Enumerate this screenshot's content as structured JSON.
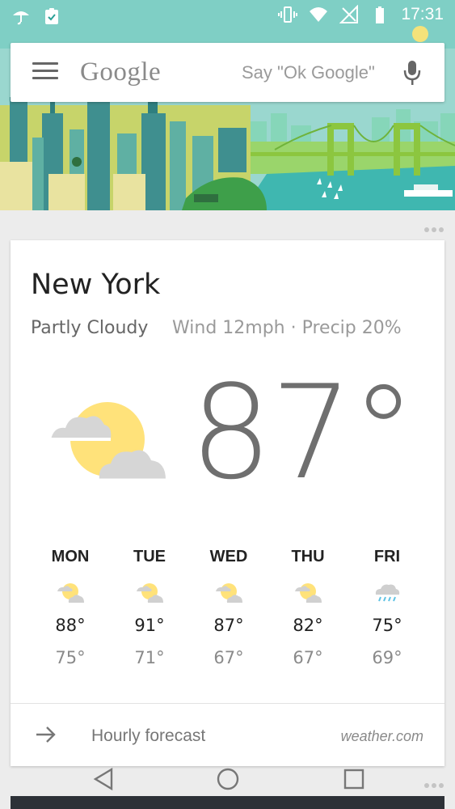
{
  "status_bar": {
    "time": "17:31",
    "left_icons": [
      "umbrella-icon",
      "clipboard-check-icon"
    ],
    "right_icons": [
      "vibrate-icon",
      "wifi-icon",
      "no-signal-icon",
      "battery-icon"
    ]
  },
  "search": {
    "logo": "Google",
    "placeholder": "Say \"Ok Google\"",
    "menu_icon": "hamburger-menu-icon",
    "mic_icon": "microphone-icon"
  },
  "weather": {
    "city": "New York",
    "condition": "Partly Cloudy",
    "details": "Wind 12mph · Precip 20%",
    "temperature": "87°",
    "icon": "partly-cloudy-icon",
    "forecast": [
      {
        "day": "MON",
        "high": "88°",
        "low": "75°",
        "icon": "partly-cloudy-icon"
      },
      {
        "day": "TUE",
        "high": "91°",
        "low": "71°",
        "icon": "partly-cloudy-icon"
      },
      {
        "day": "WED",
        "high": "87°",
        "low": "67°",
        "icon": "partly-cloudy-icon"
      },
      {
        "day": "THU",
        "high": "82°",
        "low": "67°",
        "icon": "partly-cloudy-icon"
      },
      {
        "day": "FRI",
        "high": "75°",
        "low": "69°",
        "icon": "rain-icon"
      }
    ],
    "footer": {
      "link_label": "Hourly forecast",
      "source": "weather.com"
    }
  },
  "navigation": {
    "back_icon": "back-triangle-icon",
    "home_icon": "home-circle-icon",
    "recents_icon": "recents-square-icon"
  },
  "colors": {
    "sky": "#7fd1c4",
    "water": "#3fb7b0",
    "sun": "#ffe27a",
    "cloud": "#d6d6d6",
    "card_bg": "#ffffff",
    "page_bg": "#ececec"
  }
}
